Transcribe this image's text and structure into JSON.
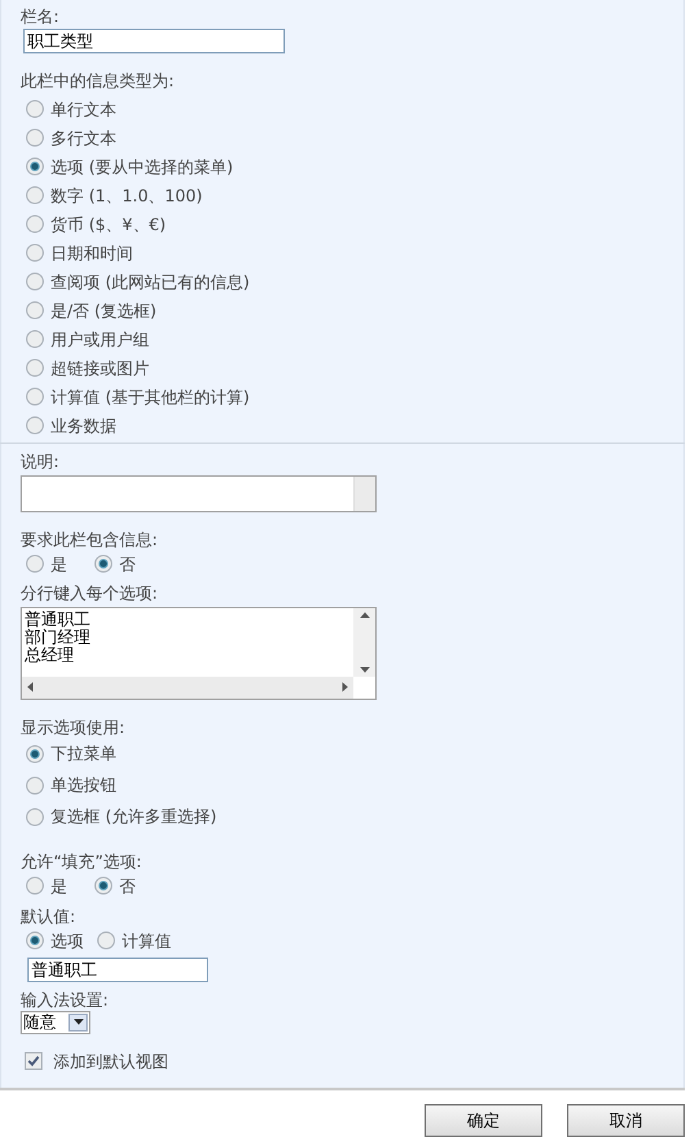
{
  "column_name": {
    "label": "栏名:",
    "value": "职工类型"
  },
  "type": {
    "label": "此栏中的信息类型为:",
    "options": [
      {
        "label": "单行文本",
        "selected": false
      },
      {
        "label": "多行文本",
        "selected": false
      },
      {
        "label": "选项 (要从中选择的菜单)",
        "selected": true
      },
      {
        "label": "数字 (1、1.0、100)",
        "selected": false
      },
      {
        "label": "货币 ($、¥、€)",
        "selected": false
      },
      {
        "label": "日期和时间",
        "selected": false
      },
      {
        "label": "查阅项 (此网站已有的信息)",
        "selected": false
      },
      {
        "label": "是/否 (复选框)",
        "selected": false
      },
      {
        "label": "用户或用户组",
        "selected": false
      },
      {
        "label": "超链接或图片",
        "selected": false
      },
      {
        "label": "计算值 (基于其他栏的计算)",
        "selected": false
      },
      {
        "label": "业务数据",
        "selected": false
      }
    ]
  },
  "description": {
    "label": "说明:"
  },
  "required": {
    "label": "要求此栏包含信息:",
    "options": [
      {
        "label": "是",
        "selected": false
      },
      {
        "label": "否",
        "selected": true
      }
    ]
  },
  "choices": {
    "label": "分行键入每个选项:",
    "lines": [
      "普通职工",
      "部门经理",
      "总经理"
    ]
  },
  "display": {
    "label": "显示选项使用:",
    "options": [
      {
        "label": "下拉菜单",
        "selected": true
      },
      {
        "label": "单选按钮",
        "selected": false
      },
      {
        "label": "复选框 (允许多重选择)",
        "selected": false
      }
    ]
  },
  "fill_in": {
    "label": "允许“填充”选项:",
    "options": [
      {
        "label": "是",
        "selected": false
      },
      {
        "label": "否",
        "selected": true
      }
    ]
  },
  "default": {
    "label": "默认值:",
    "options": [
      {
        "label": "选项",
        "selected": true
      },
      {
        "label": "计算值",
        "selected": false
      }
    ],
    "value": "普通职工"
  },
  "ime": {
    "label": "输入法设置:",
    "value": "随意"
  },
  "add_to_view": {
    "label": "添加到默认视图",
    "checked": true
  },
  "buttons": [
    "确定",
    "取消"
  ]
}
